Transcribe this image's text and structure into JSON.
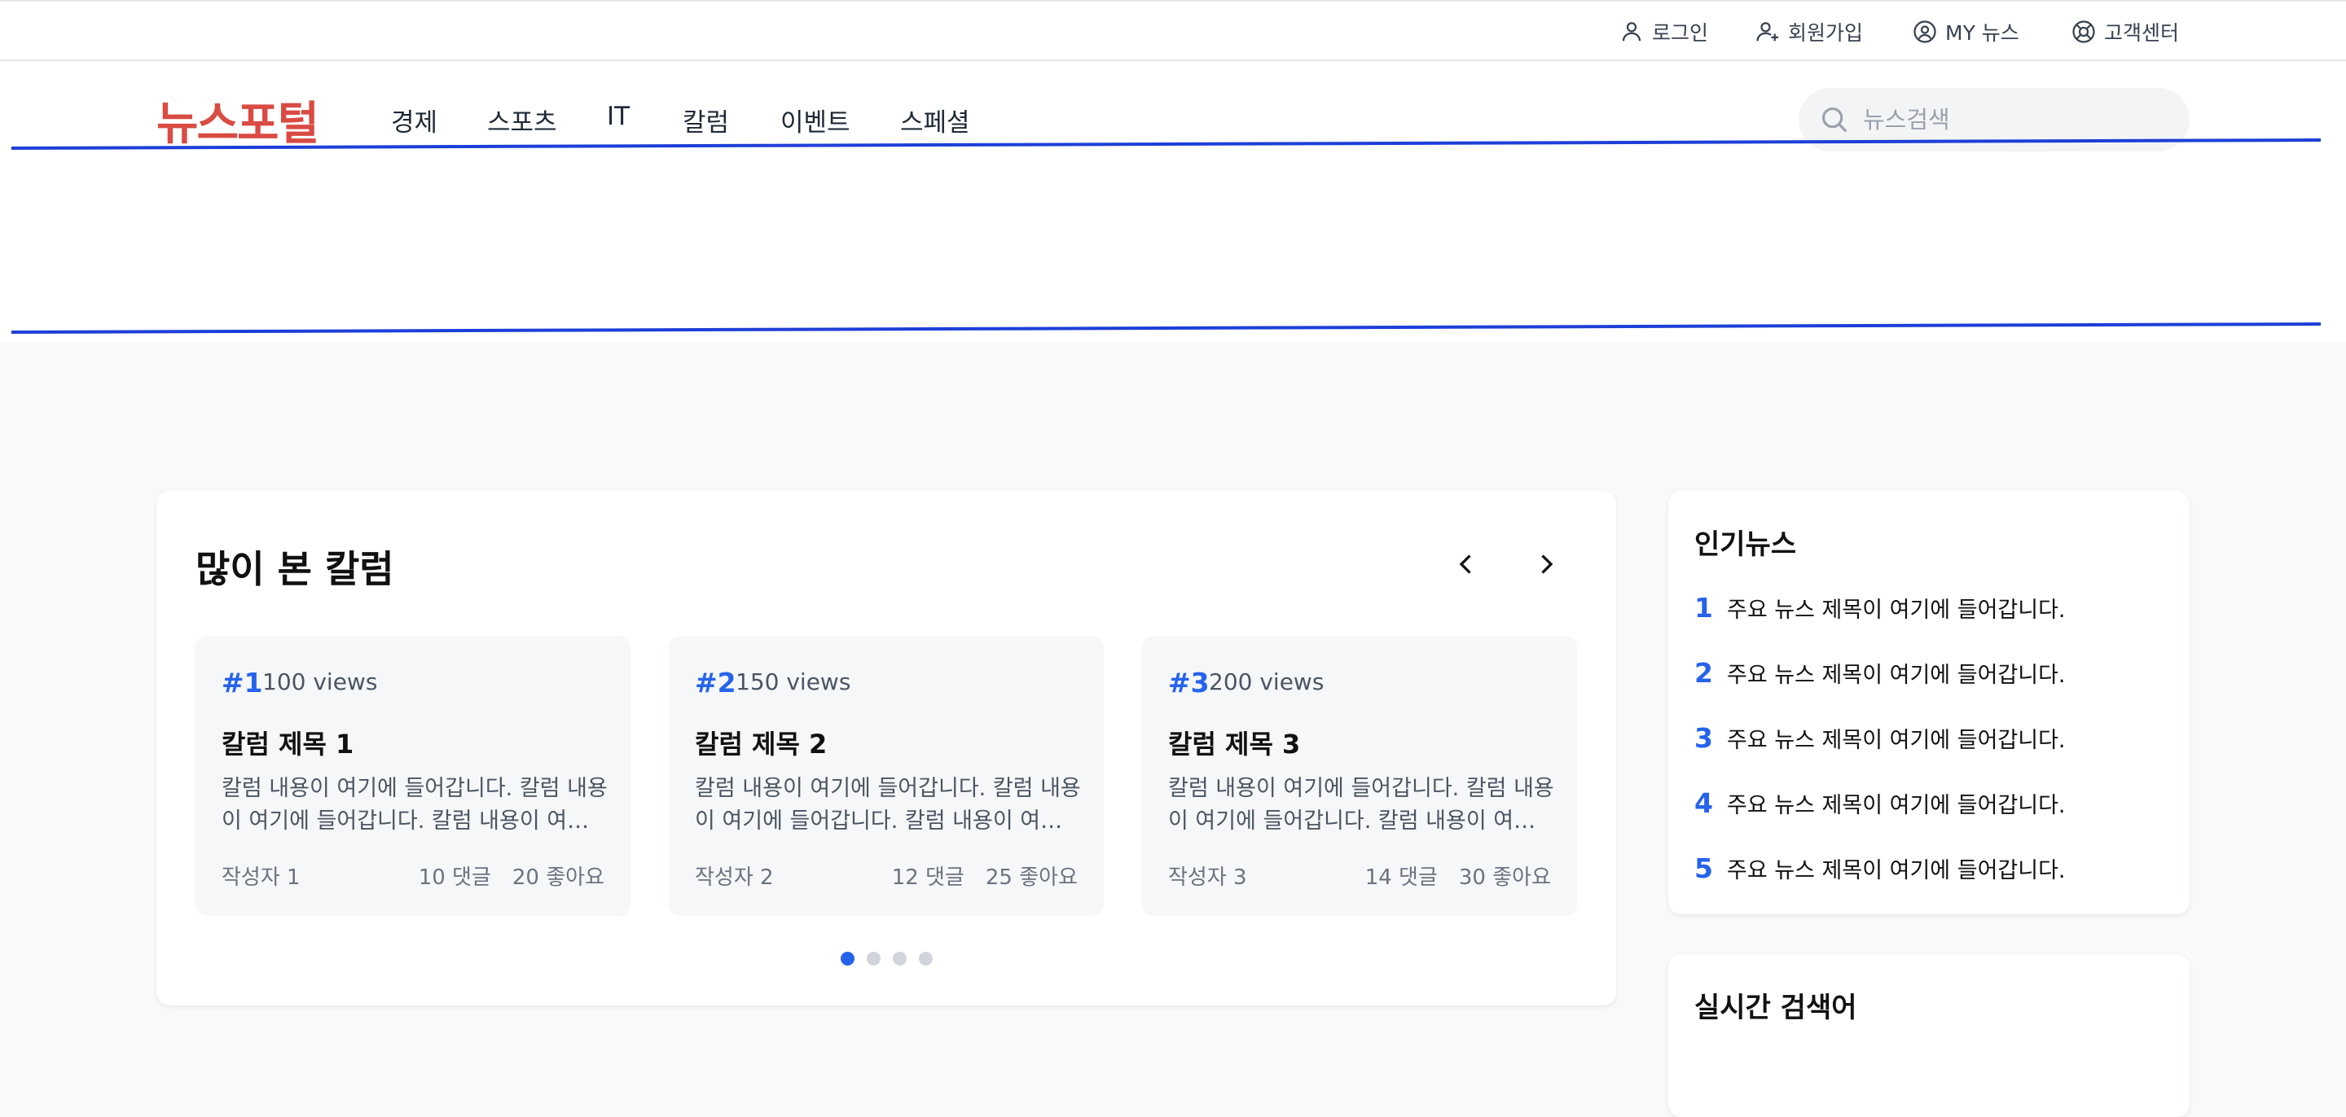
{
  "util_bar": {
    "login": "로그인",
    "signup": "회원가입",
    "my_news": "MY 뉴스",
    "support": "고객센터"
  },
  "header": {
    "logo": "뉴스포털",
    "nav": [
      "경제",
      "스포츠",
      "IT",
      "칼럼",
      "이벤트",
      "스페셜"
    ],
    "search_placeholder": "뉴스검색"
  },
  "colors": {
    "accent": "#2563eb",
    "logo": "#d94b43",
    "banner_line": "#1d3fd8"
  },
  "popular_columns": {
    "title": "많이 본 칼럼",
    "cards": [
      {
        "rank": "#1",
        "views": "100 views",
        "title": "칼럼 제목 1",
        "body_line1": "칼럼 내용이 여기에 들어갑니다. 칼럼 내용",
        "body_line2": "이 여기에 들어갑니다. 칼럼 내용이 여기에 들어갑니다.",
        "author": "작성자 1",
        "comments": "10 댓글",
        "likes": "20 좋아요"
      },
      {
        "rank": "#2",
        "views": "150 views",
        "title": "칼럼 제목 2",
        "body_line1": "칼럼 내용이 여기에 들어갑니다. 칼럼 내용",
        "body_line2": "이 여기에 들어갑니다. 칼럼 내용이 여기에 들어갑니다.",
        "author": "작성자 2",
        "comments": "12 댓글",
        "likes": "25 좋아요"
      },
      {
        "rank": "#3",
        "views": "200 views",
        "title": "칼럼 제목 3",
        "body_line1": "칼럼 내용이 여기에 들어갑니다. 칼럼 내용",
        "body_line2": "이 여기에 들어갑니다. 칼럼 내용이 여기에 들어갑니다.",
        "author": "작성자 3",
        "comments": "14 댓글",
        "likes": "30 좋아요"
      }
    ],
    "pagination": {
      "total": 4,
      "active": 1
    }
  },
  "popular_news": {
    "title": "인기뉴스",
    "items": [
      {
        "num": "1",
        "text": "주요 뉴스 제목이 여기에 들어갑니다."
      },
      {
        "num": "2",
        "text": "주요 뉴스 제목이 여기에 들어갑니다."
      },
      {
        "num": "3",
        "text": "주요 뉴스 제목이 여기에 들어갑니다."
      },
      {
        "num": "4",
        "text": "주요 뉴스 제목이 여기에 들어갑니다."
      },
      {
        "num": "5",
        "text": "주요 뉴스 제목이 여기에 들어갑니다."
      }
    ]
  },
  "realtime_search": {
    "title": "실시간 검색어"
  }
}
